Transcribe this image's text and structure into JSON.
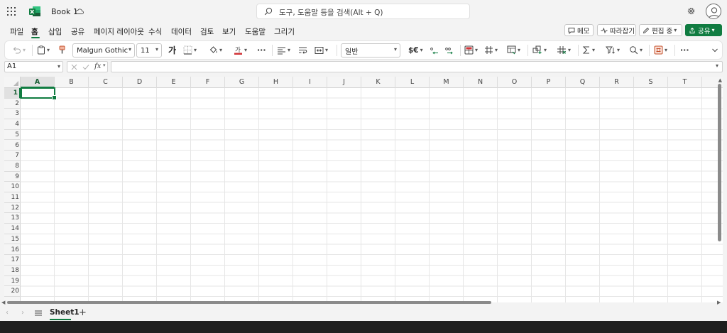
{
  "app": {
    "document_title": "Book 1",
    "search_placeholder": "도구, 도움말 등을 검색(Alt + Q)"
  },
  "menu": {
    "tabs": [
      "파일",
      "홈",
      "삽입",
      "공유",
      "페이지 레이아웃",
      "수식",
      "데이터",
      "검토",
      "보기",
      "도움말",
      "그리기"
    ],
    "active_tab": "홈"
  },
  "right_buttons": {
    "memo": "메모",
    "catchup": "따라잡기",
    "editing": "편집 중",
    "share": "공유"
  },
  "ribbon": {
    "font_name": "Malgun Gothic",
    "font_size": "11",
    "font_style_glyph": "가",
    "number_format": "일반",
    "currency_glyph": "$€",
    "more": "···"
  },
  "formula_bar": {
    "name_box": "A1",
    "fx_label": "fx",
    "formula_value": ""
  },
  "grid": {
    "columns": [
      "A",
      "B",
      "C",
      "D",
      "E",
      "F",
      "G",
      "H",
      "I",
      "J",
      "K",
      "L",
      "M",
      "N",
      "O",
      "P",
      "Q",
      "R",
      "S",
      "T"
    ],
    "rows": [
      "1",
      "2",
      "3",
      "4",
      "5",
      "6",
      "7",
      "8",
      "9",
      "10",
      "11",
      "12",
      "13",
      "14",
      "15",
      "16",
      "17",
      "18",
      "19",
      "20"
    ],
    "active_cell": "A1"
  },
  "sheets": {
    "tabs": [
      "Sheet1"
    ],
    "active": "Sheet1",
    "add_label": "+"
  },
  "colors": {
    "accent": "#107c41",
    "font_color_underline": "#d13438"
  }
}
